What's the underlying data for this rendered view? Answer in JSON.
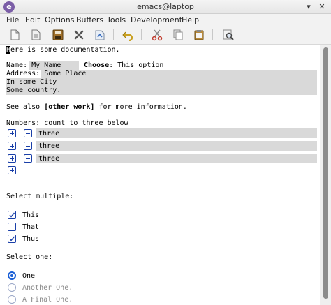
{
  "window": {
    "title": "emacs@laptop",
    "minimize_glyph": "▾",
    "close_glyph": "✕"
  },
  "menu": {
    "items": [
      "File",
      "Edit",
      "Options",
      "Buffers",
      "Tools",
      "Development",
      "Help"
    ]
  },
  "toolbar": {
    "icons": [
      "new-file-icon",
      "open-file-icon",
      "save-icon",
      "close-buffer-icon",
      "save-as-icon",
      "undo-icon",
      "cut-icon",
      "copy-icon",
      "paste-icon",
      "search-icon"
    ]
  },
  "buffer": {
    "doc_first": "H",
    "doc_rest": "ere is some documentation.",
    "name_label": "Name: ",
    "name_value": "My Name",
    "choose_label": "Choose",
    "choose_value": ": This option",
    "address_label": "Address: ",
    "address_line1": "Some Place",
    "address_line2": "In some City",
    "address_line3": "Some country.",
    "see_also_prefix": "See also ",
    "see_also_link": "[other work]",
    "see_also_suffix": " for more information.",
    "numbers_label": "Numbers: count to three below",
    "numbers": [
      "three",
      "three",
      "three"
    ],
    "select_multiple_label": "Select multiple:",
    "checkboxes": [
      {
        "label": "This",
        "checked": true
      },
      {
        "label": "That",
        "checked": false
      },
      {
        "label": "Thus",
        "checked": true
      }
    ],
    "select_one_label": "Select one:",
    "radios": [
      {
        "label": "One",
        "selected": true
      },
      {
        "label": "Another One.",
        "selected": false
      },
      {
        "label": "A Final One.",
        "selected": false
      }
    ]
  },
  "colors": {
    "accent": "#1a3fa8",
    "field_bg": "#d9d9d9",
    "logo": "#7b5ea7"
  }
}
